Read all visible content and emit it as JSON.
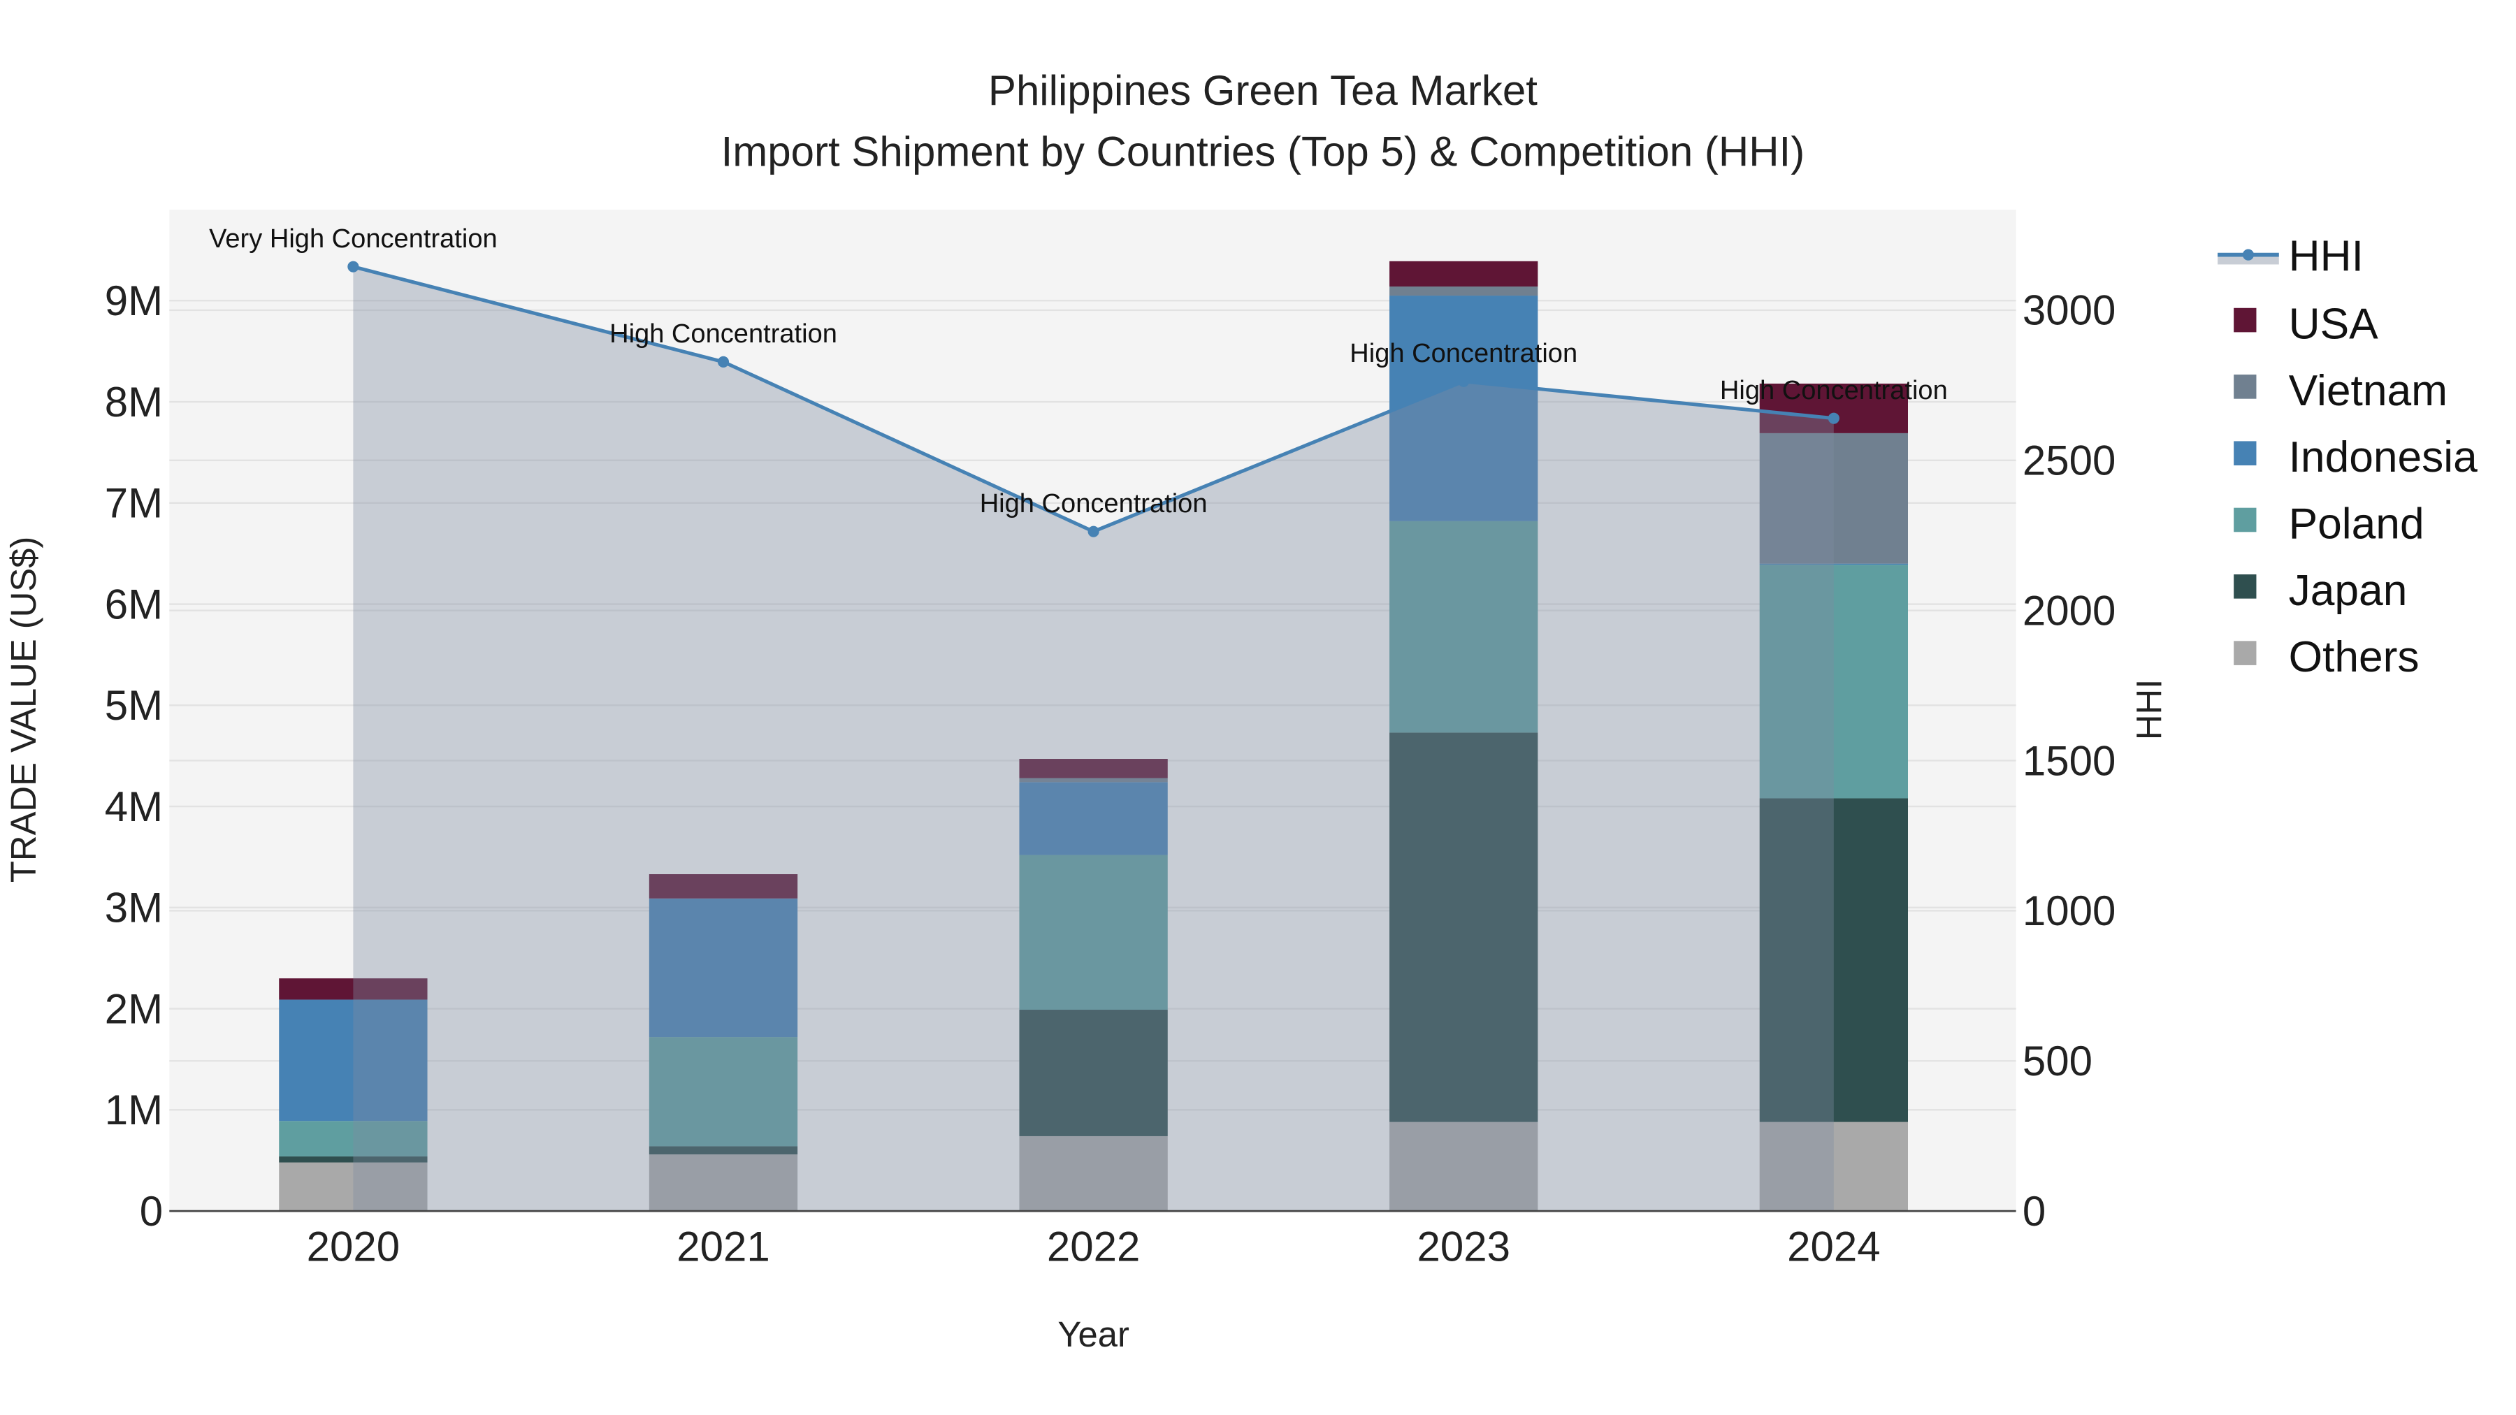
{
  "chart_data": {
    "type": "bar",
    "title": "Philippines Green Tea Market",
    "subtitle": "Import Shipment by Countries (Top 5) & Competition (HHI)",
    "xlabel": "Year",
    "ylabel": "TRADE VALUE (US$)",
    "y2label": "HHI",
    "categories": [
      "2020",
      "2021",
      "2022",
      "2023",
      "2024"
    ],
    "ylim": [
      0,
      9900000
    ],
    "y2lim": [
      0,
      3335
    ],
    "yticks": [
      0,
      1000000,
      2000000,
      3000000,
      4000000,
      5000000,
      6000000,
      7000000,
      8000000,
      9000000
    ],
    "yticklabels": [
      "0",
      "1M",
      "2M",
      "3M",
      "4M",
      "5M",
      "6M",
      "7M",
      "8M",
      "9M"
    ],
    "y2ticks": [
      0,
      500,
      1000,
      1500,
      2000,
      2500,
      3000
    ],
    "y2ticklabels": [
      "0",
      "500",
      "1000",
      "1500",
      "2000",
      "2500",
      "3000"
    ],
    "stacked": true,
    "series": [
      {
        "name": "Others",
        "color": "#a9a9a9",
        "values": [
          480000,
          560000,
          740000,
          880000,
          880000
        ]
      },
      {
        "name": "Japan",
        "color": "#2f4f4f",
        "values": [
          60000,
          80000,
          1250000,
          3850000,
          3200000
        ]
      },
      {
        "name": "Poland",
        "color": "#5f9ea0",
        "values": [
          350000,
          1080000,
          1530000,
          2090000,
          2310000
        ]
      },
      {
        "name": "Indonesia",
        "color": "#4682b4",
        "values": [
          1200000,
          1370000,
          720000,
          2230000,
          10000
        ]
      },
      {
        "name": "Vietnam",
        "color": "#708090",
        "values": [
          0,
          0,
          40000,
          90000,
          1290000
        ]
      },
      {
        "name": "USA",
        "color": "#5f1535",
        "values": [
          210000,
          240000,
          190000,
          250000,
          490000
        ]
      }
    ],
    "hhi": {
      "name": "HHI",
      "color": "#4682b4",
      "values": [
        3145,
        2828,
        2263,
        2763,
        2640
      ],
      "annotations": [
        "Very High Concentration",
        "High Concentration",
        "High Concentration",
        "High Concentration",
        "High Concentration"
      ]
    },
    "legend": [
      "HHI",
      "USA",
      "Vietnam",
      "Indonesia",
      "Poland",
      "Japan",
      "Others"
    ],
    "legend_position": "right",
    "grid": true
  }
}
